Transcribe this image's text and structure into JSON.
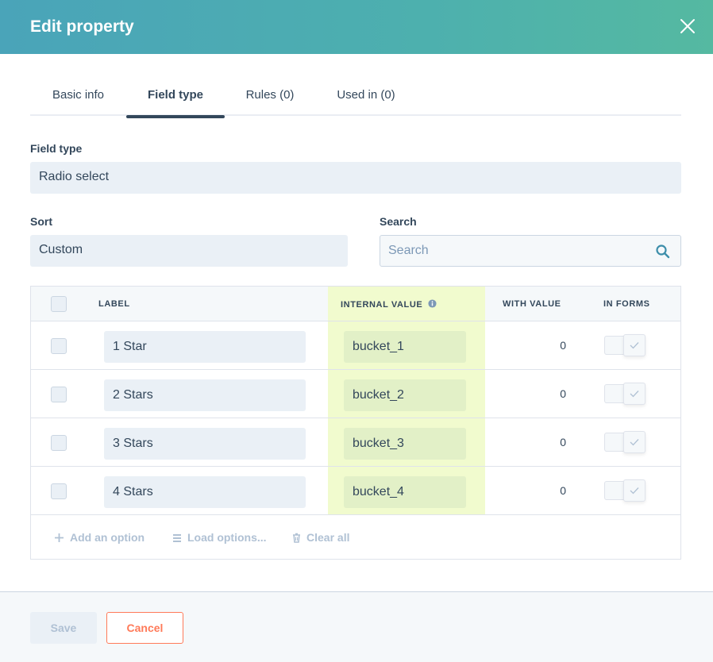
{
  "dialog": {
    "title": "Edit property",
    "close_icon": "close-icon"
  },
  "tabs": [
    {
      "label": "Basic info",
      "active": false
    },
    {
      "label": "Field type",
      "active": true
    },
    {
      "label": "Rules (0)",
      "active": false
    },
    {
      "label": "Used in (0)",
      "active": false
    }
  ],
  "field_type": {
    "label": "Field type",
    "value": "Radio select"
  },
  "sort": {
    "label": "Sort",
    "value": "Custom"
  },
  "search": {
    "label": "Search",
    "placeholder": "Search",
    "value": "",
    "icon": "search-icon"
  },
  "table": {
    "columns": {
      "label": "LABEL",
      "internal_value": "INTERNAL VALUE",
      "with_value": "WITH VALUE",
      "in_forms": "IN FORMS"
    },
    "highlight_color": "#f1fbce",
    "rows": [
      {
        "label": "1 Star",
        "internal_value": "bucket_1",
        "with_value": "0",
        "in_forms": false,
        "selected": false
      },
      {
        "label": "2 Stars",
        "internal_value": "bucket_2",
        "with_value": "0",
        "in_forms": false,
        "selected": false
      },
      {
        "label": "3 Stars",
        "internal_value": "bucket_3",
        "with_value": "0",
        "in_forms": false,
        "selected": false
      },
      {
        "label": "4 Stars",
        "internal_value": "bucket_4",
        "with_value": "0",
        "in_forms": false,
        "selected": false
      }
    ],
    "actions": {
      "add": "Add an option",
      "load": "Load options...",
      "clear": "Clear all"
    }
  },
  "footer": {
    "save_label": "Save",
    "cancel_label": "Cancel",
    "accent_color": "#ff7a59"
  }
}
